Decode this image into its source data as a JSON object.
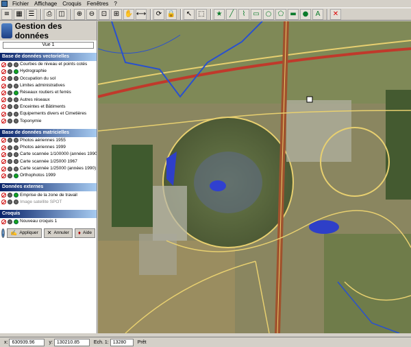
{
  "menu": {
    "items": [
      "Fichier",
      "Affichage",
      "Croquis",
      "Fenêtres",
      "?"
    ]
  },
  "toolbar": {
    "groups": [
      [
        "layers-icon",
        "table-icon",
        "list-icon"
      ],
      [
        "print-icon",
        "print-preview-icon"
      ],
      [
        "zoom-in-icon",
        "zoom-out-icon",
        "zoom-window-icon",
        "zoom-extent-icon",
        "pan-icon",
        "measure-icon"
      ],
      [
        "refresh-icon",
        "lock-icon"
      ],
      [
        "select-arrow-icon",
        "select-area-icon"
      ],
      [
        "star-icon",
        "line-icon",
        "polyline-icon",
        "rectangle-icon",
        "circle-icon",
        "polygon-icon",
        "filled-rectangle-icon",
        "filled-circle-icon",
        "text-icon"
      ],
      [
        "delete-icon"
      ]
    ]
  },
  "panel": {
    "title": "Gestion des données",
    "view": "Vue 1",
    "sections": [
      {
        "title": "Base de données vectorielles",
        "rows": [
          {
            "label": "Courbes de niveau et points cotés",
            "icon": "i2"
          },
          {
            "label": "Hydrographie",
            "icon": "i3"
          },
          {
            "label": "Occupation du sol",
            "icon": "i2"
          },
          {
            "label": "Limites administratives",
            "icon": "i2"
          },
          {
            "label": "Réseaux routiers et ferrés",
            "icon": "i3"
          },
          {
            "label": "Autres réseaux",
            "icon": "i2"
          },
          {
            "label": "Enceintes et Bâtiments",
            "icon": "i2"
          },
          {
            "label": "Equipements divers et Cimetières",
            "icon": "i2"
          },
          {
            "label": "Toponymie",
            "icon": "i2"
          }
        ]
      },
      {
        "title": "Base de données matricielles",
        "rows": [
          {
            "label": "Photos aériennes 1955",
            "icon": "i2"
          },
          {
            "label": "Photos aériennes 1999",
            "icon": "i2"
          },
          {
            "label": "Carte scannée 1/100000 (années 1990)",
            "icon": "i2"
          },
          {
            "label": "Carte scannée 1/25000 1967",
            "icon": "i2"
          },
          {
            "label": "Carte scannée 1/25000 (années 1990)",
            "icon": "i2"
          },
          {
            "label": "Orthophotos 1999",
            "icon": "i3"
          }
        ]
      },
      {
        "title": "Données externes",
        "rows": [
          {
            "label": "Emprise de la zone de travail",
            "icon": "i3"
          },
          {
            "label": "Image satellite SPOT",
            "icon": "i2",
            "off": true
          }
        ]
      },
      {
        "title": "Croquis",
        "rows": [
          {
            "label": "Nouveau croquis 1",
            "icon": "i3"
          }
        ]
      }
    ],
    "buttons": {
      "info": "i",
      "apply": "Appliquer",
      "cancel": "Annuler",
      "help": "Aide"
    }
  },
  "status": {
    "x_label": "x:",
    "x_value": "630939.96",
    "y_label": "y:",
    "y_value": "130210.85",
    "scale_label": "Ech. 1:",
    "scale_value": "13280",
    "state": "Prêt"
  },
  "colors": {
    "section_header": "#0a246a",
    "layer_on": "#1aa21a",
    "road": "#f0d060",
    "railway": "#c0392b"
  }
}
